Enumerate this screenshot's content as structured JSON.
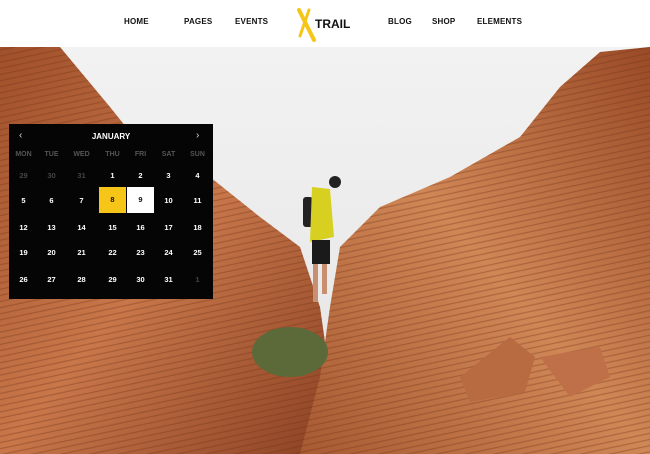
{
  "nav": {
    "left": [
      "HOME",
      "PAGES",
      "EVENTS"
    ],
    "right": [
      "BLOG",
      "SHOP",
      "ELEMENTS"
    ],
    "logo": "TRAIL"
  },
  "calendar": {
    "month": "JANUARY",
    "prev": "‹",
    "next": "›",
    "weekdays": [
      "MON",
      "TUE",
      "WED",
      "THU",
      "FRI",
      "SAT",
      "SUN"
    ],
    "weeks": [
      [
        "29",
        "30",
        "31",
        "1",
        "2",
        "3",
        "4"
      ],
      [
        "5",
        "6",
        "7",
        "8",
        "9",
        "10",
        "11"
      ],
      [
        "12",
        "13",
        "14",
        "15",
        "16",
        "17",
        "18"
      ],
      [
        "19",
        "20",
        "21",
        "22",
        "23",
        "24",
        "25"
      ],
      [
        "26",
        "27",
        "28",
        "29",
        "30",
        "31",
        "1"
      ]
    ],
    "selected": "8",
    "hovered": "9",
    "accent": "#f5c518"
  }
}
